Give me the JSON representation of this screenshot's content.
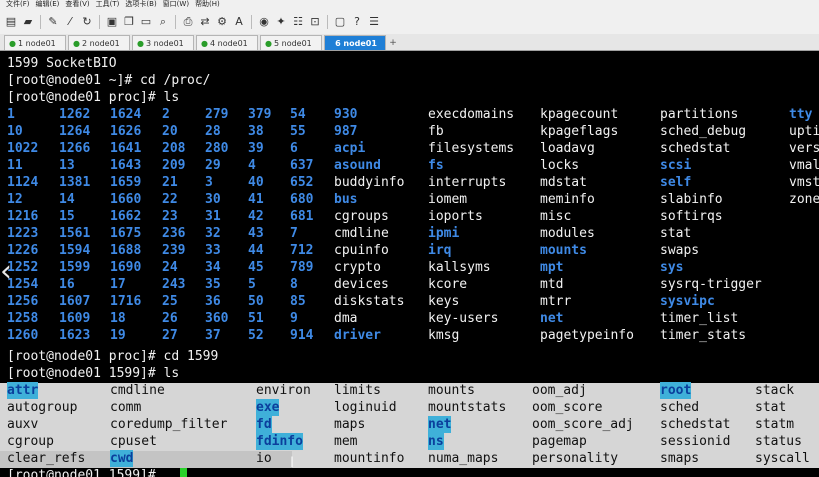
{
  "menu": [
    "文件(F)",
    "编辑(E)",
    "查看(V)",
    "工具(T)",
    "选项卡(B)",
    "窗口(W)",
    "帮助(H)"
  ],
  "toolbar_icons": [
    "new-session-icon",
    "open-folder-icon",
    "connect-icon",
    "disconnect-icon",
    "reconnect-icon",
    "properties-icon",
    "copy-icon",
    "paste-icon",
    "find-icon",
    "print-icon",
    "transfer-icon",
    "settings-icon",
    "script-icon",
    "lock-icon",
    "sftp-icon",
    "fullscreen-icon",
    "help-icon",
    "chat-icon"
  ],
  "tabs": [
    {
      "label": "1 node01",
      "active": false
    },
    {
      "label": "2 node01",
      "active": false
    },
    {
      "label": "3 node01",
      "active": false
    },
    {
      "label": "4 node01",
      "active": false
    },
    {
      "label": "5 node01",
      "active": false
    },
    {
      "label": "6 node01",
      "active": true
    }
  ],
  "tab_add": "+",
  "terminal": {
    "line_top": "1599 SocketBIO",
    "cmd1": "[root@node01 ~]# cd /proc/",
    "cmd2": "[root@node01 proc]# ls",
    "proc_columns": [
      [
        {
          "t": "1",
          "d": true
        },
        {
          "t": "10",
          "d": true
        },
        {
          "t": "1022",
          "d": true
        },
        {
          "t": "11",
          "d": true
        },
        {
          "t": "1124",
          "d": true
        },
        {
          "t": "12",
          "d": true
        },
        {
          "t": "1216",
          "d": true
        },
        {
          "t": "1223",
          "d": true
        },
        {
          "t": "1226",
          "d": true
        },
        {
          "t": "1252",
          "d": true
        },
        {
          "t": "1254",
          "d": true
        },
        {
          "t": "1256",
          "d": true
        },
        {
          "t": "1258",
          "d": true
        },
        {
          "t": "1260",
          "d": true
        }
      ],
      [
        {
          "t": "1262",
          "d": true
        },
        {
          "t": "1264",
          "d": true
        },
        {
          "t": "1266",
          "d": true
        },
        {
          "t": "13",
          "d": true
        },
        {
          "t": "1381",
          "d": true
        },
        {
          "t": "14",
          "d": true
        },
        {
          "t": "15",
          "d": true
        },
        {
          "t": "1561",
          "d": true
        },
        {
          "t": "1594",
          "d": true
        },
        {
          "t": "1599",
          "d": true
        },
        {
          "t": "16",
          "d": true
        },
        {
          "t": "1607",
          "d": true
        },
        {
          "t": "1609",
          "d": true
        },
        {
          "t": "1623",
          "d": true
        }
      ],
      [
        {
          "t": "1624",
          "d": true
        },
        {
          "t": "1626",
          "d": true
        },
        {
          "t": "1641",
          "d": true
        },
        {
          "t": "1643",
          "d": true
        },
        {
          "t": "1659",
          "d": true
        },
        {
          "t": "1660",
          "d": true
        },
        {
          "t": "1662",
          "d": true
        },
        {
          "t": "1675",
          "d": true
        },
        {
          "t": "1688",
          "d": true
        },
        {
          "t": "1690",
          "d": true
        },
        {
          "t": "17",
          "d": true
        },
        {
          "t": "1716",
          "d": true
        },
        {
          "t": "18",
          "d": true
        },
        {
          "t": "19",
          "d": true
        }
      ],
      [
        {
          "t": "2",
          "d": true
        },
        {
          "t": "20",
          "d": true
        },
        {
          "t": "208",
          "d": true
        },
        {
          "t": "209",
          "d": true
        },
        {
          "t": "21",
          "d": true
        },
        {
          "t": "22",
          "d": true
        },
        {
          "t": "23",
          "d": true
        },
        {
          "t": "236",
          "d": true
        },
        {
          "t": "239",
          "d": true
        },
        {
          "t": "24",
          "d": true
        },
        {
          "t": "243",
          "d": true
        },
        {
          "t": "25",
          "d": true
        },
        {
          "t": "26",
          "d": true
        },
        {
          "t": "27",
          "d": true
        }
      ],
      [
        {
          "t": "279",
          "d": true
        },
        {
          "t": "28",
          "d": true
        },
        {
          "t": "280",
          "d": true
        },
        {
          "t": "29",
          "d": true
        },
        {
          "t": "3",
          "d": true
        },
        {
          "t": "30",
          "d": true
        },
        {
          "t": "31",
          "d": true
        },
        {
          "t": "32",
          "d": true
        },
        {
          "t": "33",
          "d": true
        },
        {
          "t": "34",
          "d": true
        },
        {
          "t": "35",
          "d": true
        },
        {
          "t": "36",
          "d": true
        },
        {
          "t": "360",
          "d": true
        },
        {
          "t": "37",
          "d": true
        }
      ],
      [
        {
          "t": "379",
          "d": true
        },
        {
          "t": "38",
          "d": true
        },
        {
          "t": "39",
          "d": true
        },
        {
          "t": "4",
          "d": true
        },
        {
          "t": "40",
          "d": true
        },
        {
          "t": "41",
          "d": true
        },
        {
          "t": "42",
          "d": true
        },
        {
          "t": "43",
          "d": true
        },
        {
          "t": "44",
          "d": true
        },
        {
          "t": "45",
          "d": true
        },
        {
          "t": "5",
          "d": true
        },
        {
          "t": "50",
          "d": true
        },
        {
          "t": "51",
          "d": true
        },
        {
          "t": "52",
          "d": true
        }
      ],
      [
        {
          "t": "54",
          "d": true
        },
        {
          "t": "55",
          "d": true
        },
        {
          "t": "6",
          "d": true
        },
        {
          "t": "637",
          "d": true
        },
        {
          "t": "652",
          "d": true
        },
        {
          "t": "680",
          "d": true
        },
        {
          "t": "681",
          "d": true
        },
        {
          "t": "7",
          "d": true
        },
        {
          "t": "712",
          "d": true
        },
        {
          "t": "789",
          "d": true
        },
        {
          "t": "8",
          "d": true
        },
        {
          "t": "85",
          "d": true
        },
        {
          "t": "9",
          "d": true
        },
        {
          "t": "914",
          "d": true
        }
      ],
      [
        {
          "t": "930",
          "d": true
        },
        {
          "t": "987",
          "d": true
        },
        {
          "t": "acpi",
          "d": true
        },
        {
          "t": "asound",
          "d": true
        },
        {
          "t": "buddyinfo",
          "d": false
        },
        {
          "t": "bus",
          "d": true
        },
        {
          "t": "cgroups",
          "d": false
        },
        {
          "t": "cmdline",
          "d": false
        },
        {
          "t": "cpuinfo",
          "d": false
        },
        {
          "t": "crypto",
          "d": false
        },
        {
          "t": "devices",
          "d": false
        },
        {
          "t": "diskstats",
          "d": false
        },
        {
          "t": "dma",
          "d": false
        },
        {
          "t": "driver",
          "d": true
        }
      ],
      [
        {
          "t": "execdomains",
          "d": false
        },
        {
          "t": "fb",
          "d": false
        },
        {
          "t": "filesystems",
          "d": false
        },
        {
          "t": "fs",
          "d": true
        },
        {
          "t": "interrupts",
          "d": false
        },
        {
          "t": "iomem",
          "d": false
        },
        {
          "t": "ioports",
          "d": false
        },
        {
          "t": "ipmi",
          "d": true
        },
        {
          "t": "irq",
          "d": true
        },
        {
          "t": "kallsyms",
          "d": false
        },
        {
          "t": "kcore",
          "d": false
        },
        {
          "t": "keys",
          "d": false
        },
        {
          "t": "key-users",
          "d": false
        },
        {
          "t": "kmsg",
          "d": false
        }
      ],
      [
        {
          "t": "kpagecount",
          "d": false
        },
        {
          "t": "kpageflags",
          "d": false
        },
        {
          "t": "loadavg",
          "d": false
        },
        {
          "t": "locks",
          "d": false
        },
        {
          "t": "mdstat",
          "d": false
        },
        {
          "t": "meminfo",
          "d": false
        },
        {
          "t": "misc",
          "d": false
        },
        {
          "t": "modules",
          "d": false
        },
        {
          "t": "mounts",
          "d": true
        },
        {
          "t": "mpt",
          "d": true
        },
        {
          "t": "mtd",
          "d": false
        },
        {
          "t": "mtrr",
          "d": false
        },
        {
          "t": "net",
          "d": true
        },
        {
          "t": "pagetypeinfo",
          "d": false
        }
      ],
      [
        {
          "t": "partitions",
          "d": false
        },
        {
          "t": "sched_debug",
          "d": false
        },
        {
          "t": "schedstat",
          "d": false
        },
        {
          "t": "scsi",
          "d": true
        },
        {
          "t": "self",
          "d": true
        },
        {
          "t": "slabinfo",
          "d": false
        },
        {
          "t": "softirqs",
          "d": false
        },
        {
          "t": "stat",
          "d": false
        },
        {
          "t": "swaps",
          "d": false
        },
        {
          "t": "sys",
          "d": true
        },
        {
          "t": "sysrq-trigger",
          "d": false
        },
        {
          "t": "sysvipc",
          "d": true
        },
        {
          "t": "timer_list",
          "d": false
        },
        {
          "t": "timer_stats",
          "d": false
        }
      ],
      [
        {
          "t": "tty",
          "d": true
        },
        {
          "t": "upti",
          "d": false
        },
        {
          "t": "vers",
          "d": false
        },
        {
          "t": "vmal",
          "d": false
        },
        {
          "t": "vmst",
          "d": false
        },
        {
          "t": "zone",
          "d": false
        }
      ]
    ],
    "cmd3": "[root@node01 proc]# cd 1599",
    "cmd4": "[root@node01 1599]# ls",
    "pid_columns": [
      [
        {
          "t": "attr",
          "d": true
        },
        {
          "t": "autogroup",
          "d": false
        },
        {
          "t": "auxv",
          "d": false
        },
        {
          "t": "cgroup",
          "d": false
        },
        {
          "t": "clear_refs",
          "d": false
        }
      ],
      [
        {
          "t": "cmdline",
          "d": false
        },
        {
          "t": "comm",
          "d": false
        },
        {
          "t": "coredump_filter",
          "d": false
        },
        {
          "t": "cpuset",
          "d": false
        },
        {
          "t": "cwd",
          "d": true
        }
      ],
      [
        {
          "t": "environ",
          "d": false
        },
        {
          "t": "exe",
          "d": true
        },
        {
          "t": "fd",
          "d": true
        },
        {
          "t": "fdinfo",
          "d": true
        },
        {
          "t": "io",
          "d": false
        }
      ],
      [
        {
          "t": "limits",
          "d": false
        },
        {
          "t": "loginuid",
          "d": false
        },
        {
          "t": "maps",
          "d": false
        },
        {
          "t": "mem",
          "d": false
        },
        {
          "t": "mountinfo",
          "d": false
        }
      ],
      [
        {
          "t": "mounts",
          "d": false
        },
        {
          "t": "mountstats",
          "d": false
        },
        {
          "t": "net",
          "d": true
        },
        {
          "t": "ns",
          "d": true
        },
        {
          "t": "numa_maps",
          "d": false
        }
      ],
      [
        {
          "t": "oom_adj",
          "d": false
        },
        {
          "t": "oom_score",
          "d": false
        },
        {
          "t": "oom_score_adj",
          "d": false
        },
        {
          "t": "pagemap",
          "d": false
        },
        {
          "t": "personality",
          "d": false
        }
      ],
      [
        {
          "t": "root",
          "d": true
        },
        {
          "t": "sched",
          "d": false
        },
        {
          "t": "schedstat",
          "d": false
        },
        {
          "t": "sessionid",
          "d": false
        },
        {
          "t": "smaps",
          "d": false
        }
      ],
      [
        {
          "t": "stack",
          "d": false
        },
        {
          "t": "stat",
          "d": false
        },
        {
          "t": "statm",
          "d": false
        },
        {
          "t": "status",
          "d": false
        },
        {
          "t": "syscall",
          "d": false
        }
      ]
    ],
    "prompt_last": "[root@node01 1599]# "
  }
}
